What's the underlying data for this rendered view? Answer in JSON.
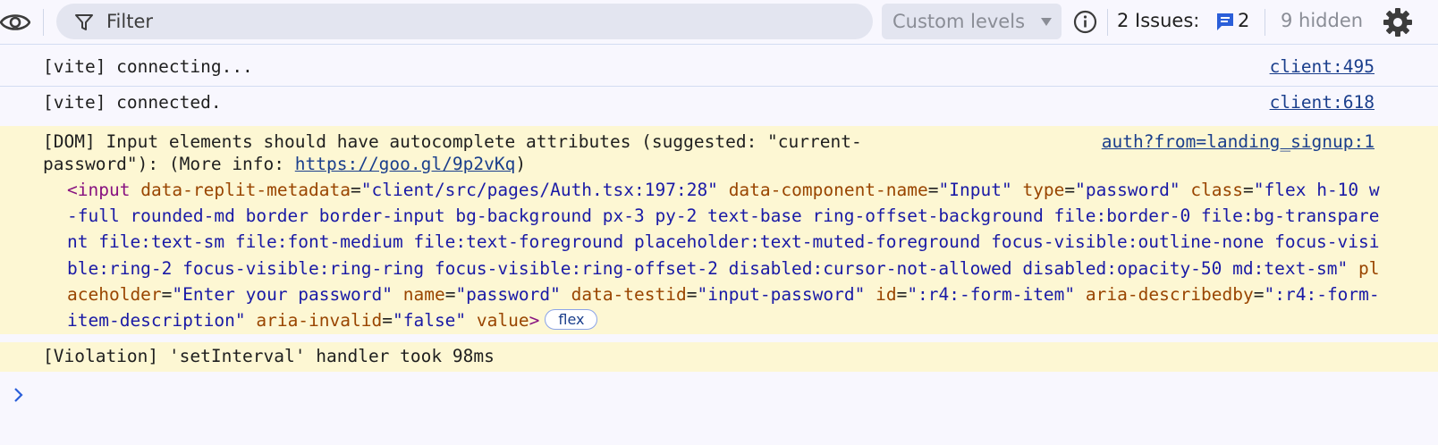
{
  "toolbar": {
    "filter_placeholder": "Filter",
    "levels_label": "Custom levels",
    "issues_label": "2 Issues:",
    "issues_count": "2",
    "hidden_label": "9 hidden",
    "icons": [
      "eye-icon",
      "filter-icon",
      "chevron-down-icon",
      "info-icon",
      "issue-message-icon",
      "gear-icon"
    ]
  },
  "messages": [
    {
      "text": "[vite] connecting...",
      "source": "client:495"
    },
    {
      "text": "[vite] connected.",
      "source": "client:618"
    }
  ],
  "warning": {
    "line1": "[DOM] Input elements should have autocomplete attributes (suggested: \"current-",
    "line2_prefix": "password\"): (More info: ",
    "link": "https://goo.gl/9p2vKq",
    "line2_suffix": ")",
    "source": "auth?from=landing_signup:1",
    "element": {
      "tag_open": "<input",
      "attrs": [
        {
          "name": "data-replit-metadata",
          "value": "\"client/src/pages/Auth.tsx:197:28\""
        },
        {
          "name": "data-component-name",
          "value": "\"Input\""
        },
        {
          "name": "type",
          "value": "\"password\""
        },
        {
          "name": "class",
          "value": "\"flex h-10 w-full rounded-md border border-input bg-background px-3 py-2 text-base ring-offset-background file:border-0 file:bg-transparent file:text-sm file:font-medium file:text-foreground placeholder:text-muted-foreground focus-visible:outline-none focus-visible:ring-2 focus-visible:ring-ring focus-visible:ring-offset-2 disabled:cursor-not-allowed disabled:opacity-50 md:text-sm\""
        },
        {
          "name": "placeholder",
          "value": "\"Enter your password\""
        },
        {
          "name": "name",
          "value": "\"password\""
        },
        {
          "name": "data-testid",
          "value": "\"input-password\""
        },
        {
          "name": "id",
          "value": "\":r4:-form-item\""
        },
        {
          "name": "aria-describedby",
          "value": "\":r4:-form-item-description\""
        },
        {
          "name": "aria-invalid",
          "value": "\"false\""
        }
      ],
      "trailing_attr": "value",
      "tag_close": ">",
      "badge": "flex"
    }
  },
  "violation": {
    "text": "[Violation] 'setInterval' handler took 98ms"
  },
  "colors": {
    "warning_bg": "#fdf7d3",
    "tag": "#881280",
    "attr_name": "#994500",
    "attr_value": "#1a1aa6",
    "link": "#1a3e8c"
  }
}
